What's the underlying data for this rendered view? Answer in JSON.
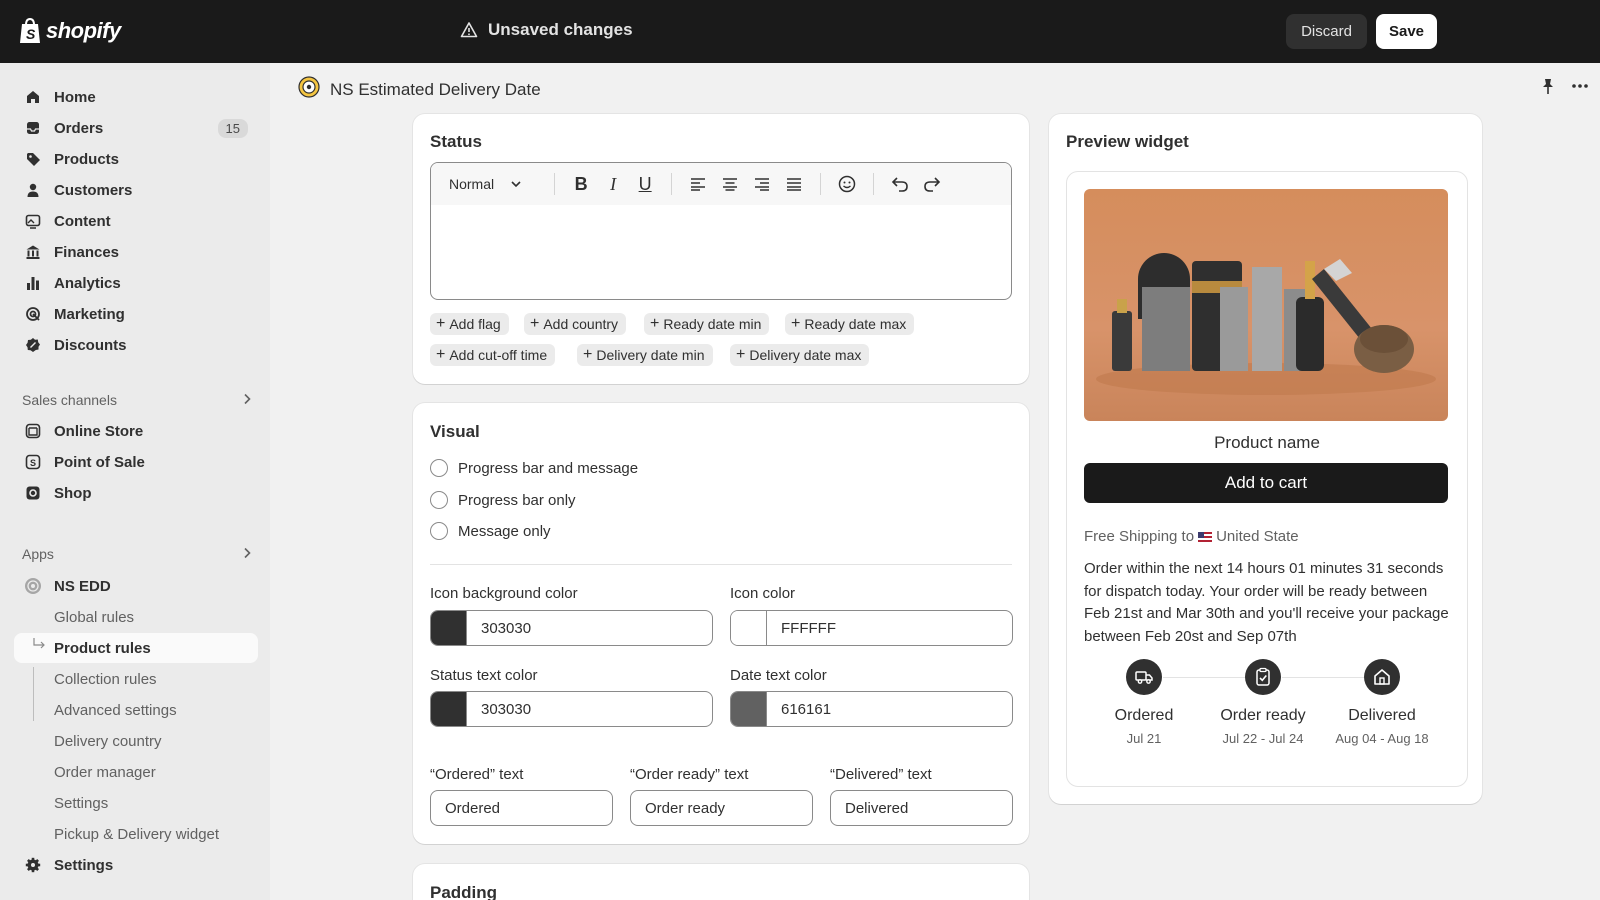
{
  "topbar": {
    "logo_text": "shopify",
    "unsaved_label": "Unsaved changes",
    "discard_label": "Discard",
    "save_label": "Save"
  },
  "sidebar": {
    "items": [
      {
        "label": "Home",
        "icon": "home-icon"
      },
      {
        "label": "Orders",
        "icon": "inbox-icon",
        "badge": "15"
      },
      {
        "label": "Products",
        "icon": "tag-icon"
      },
      {
        "label": "Customers",
        "icon": "person-icon"
      },
      {
        "label": "Content",
        "icon": "image-icon"
      },
      {
        "label": "Finances",
        "icon": "bank-icon"
      },
      {
        "label": "Analytics",
        "icon": "bar-chart-icon"
      },
      {
        "label": "Marketing",
        "icon": "target-icon"
      },
      {
        "label": "Discounts",
        "icon": "discount-icon"
      }
    ],
    "sales_channels_label": "Sales channels",
    "channels": [
      {
        "label": "Online Store",
        "icon": "store-icon"
      },
      {
        "label": "Point of Sale",
        "icon": "pos-icon"
      },
      {
        "label": "Shop",
        "icon": "shop-icon"
      }
    ],
    "apps_label": "Apps",
    "app_name": "NS EDD",
    "app_sub_items": [
      "Global rules",
      "Product rules",
      "Collection rules",
      "Advanced settings",
      "Delivery country",
      "Order manager",
      "Settings",
      "Pickup & Delivery widget"
    ],
    "active_sub_item": "Product rules",
    "settings_label": "Settings"
  },
  "page": {
    "title": "NS Estimated Delivery Date"
  },
  "status_card": {
    "title": "Status",
    "format_select": "Normal",
    "chips_row1": [
      "Add flag",
      "Add country",
      "Ready date min",
      "Ready date max"
    ],
    "chips_row2": [
      "Add cut-off time",
      "Delivery date min",
      "Delivery date max"
    ]
  },
  "visual_card": {
    "title": "Visual",
    "options": [
      "Progress bar and message",
      "Progress bar only",
      "Message only"
    ],
    "icon_bg_label": "Icon background color",
    "icon_bg_value": "303030",
    "icon_color_label": "Icon color",
    "icon_color_value": "FFFFFF",
    "status_text_label": "Status text color",
    "status_text_value": "303030",
    "date_text_label": "Date text color",
    "date_text_value": "616161",
    "ordered_text_label": "“Ordered” text",
    "ordered_text_value": "Ordered",
    "order_ready_text_label": "“Order ready” text",
    "order_ready_text_value": "Order ready",
    "delivered_text_label": "“Delivered” text",
    "delivered_text_value": "Delivered",
    "swatches": {
      "icon_bg": "#303030",
      "icon_color": "#FFFFFF",
      "status_text": "#303030",
      "date_text": "#616161"
    }
  },
  "padding_card": {
    "title": "Padding"
  },
  "preview": {
    "title": "Preview widget",
    "product_name": "Product name",
    "add_to_cart": "Add to cart",
    "free_shipping_prefix": "Free Shipping to",
    "free_shipping_country": "United State",
    "message": "Order within the next 14 hours 01 minutes 31 seconds for dispatch today. Your order will be ready between Feb 21st and Mar 30th and you'll receive your package between Feb 20st and Sep 07th",
    "steps": [
      {
        "title": "Ordered",
        "date": "Jul 21",
        "icon": "truck-icon"
      },
      {
        "title": "Order ready",
        "date": "Jul 22 - Jul 24",
        "icon": "clipboard-check-icon"
      },
      {
        "title": "Delivered",
        "date": "Aug 04 - Aug 18",
        "icon": "house-icon"
      }
    ]
  }
}
